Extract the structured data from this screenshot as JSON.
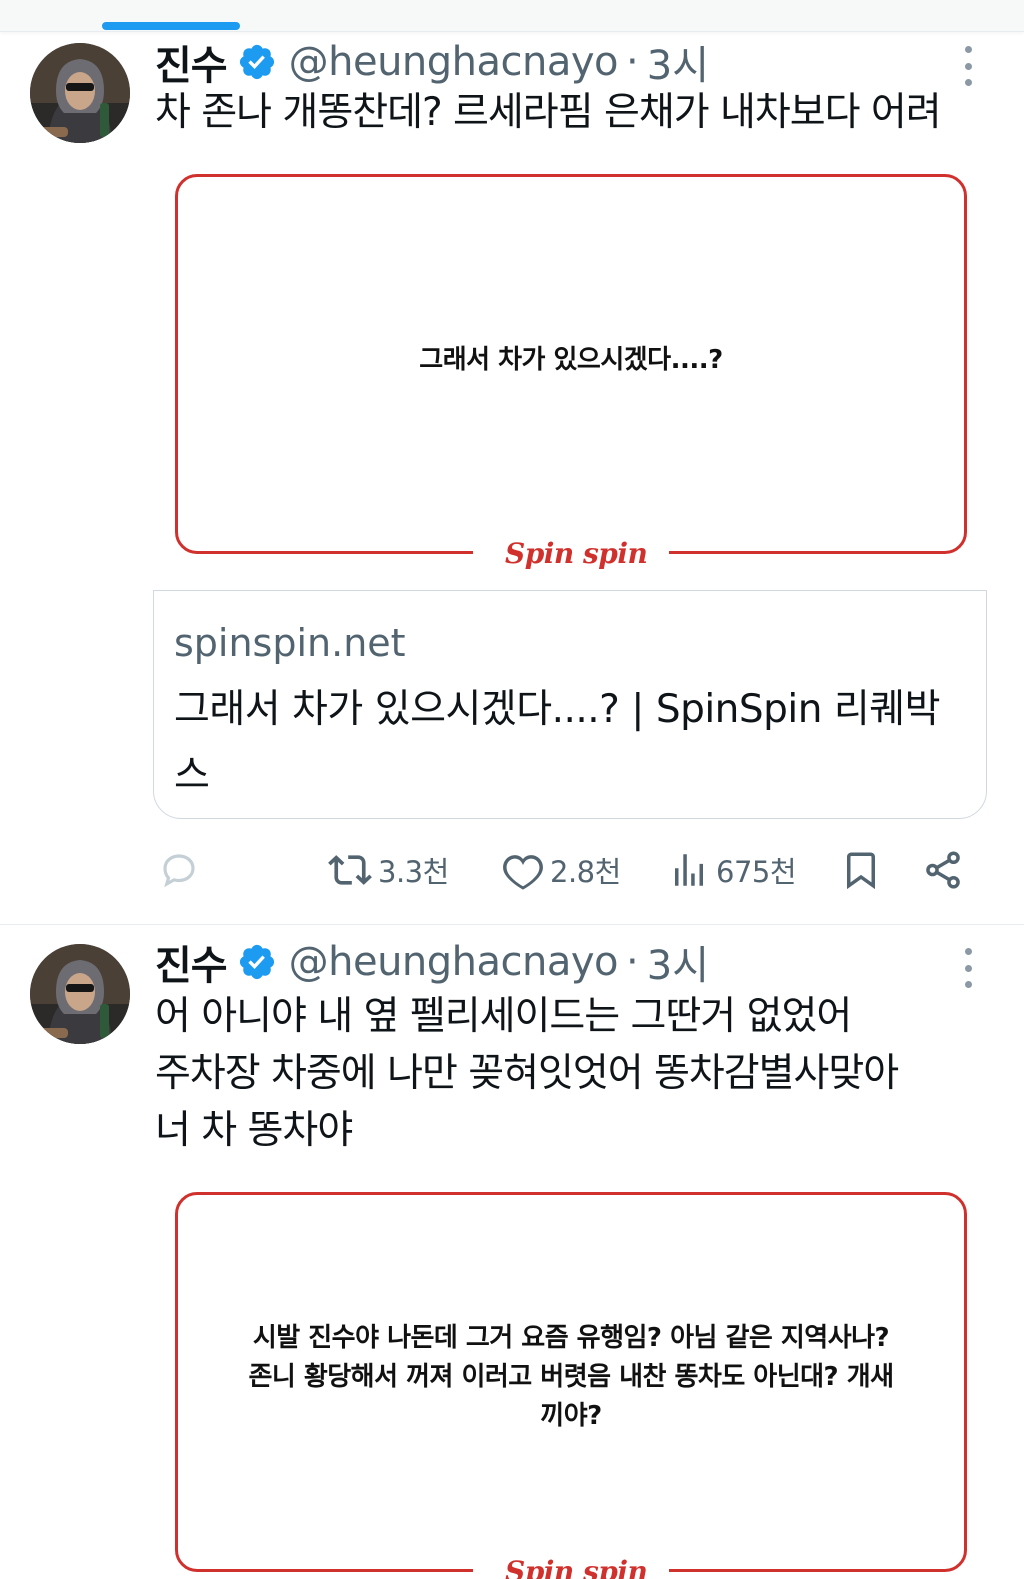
{
  "tweets": [
    {
      "author_name": "진수",
      "handle": "@heunghacnayo",
      "separator": "·",
      "time": "3시",
      "text": "차 존나 개똥찬데? 르세라핌 은채가 내차보다 어려",
      "media_text": "그래서 차가 있으시겠다....?",
      "media_brand": "Spin spin",
      "link_domain": "spinspin.net",
      "link_title": "그래서 차가 있으시겠다....? | SpinSpin 리퀘박스",
      "retweets": "3.3천",
      "likes": "2.8천",
      "views": "675천"
    },
    {
      "author_name": "진수",
      "handle": "@heunghacnayo",
      "separator": "·",
      "time": "3시",
      "text": "어 아니야 내 옆 펠리세이드는 그딴거 없었어\n주차장 차중에 나만 꽂혀잇엇어 똥차감별사맞아\n너 차 똥차야",
      "media_text": "시발 진수야 나돈데 그거 요즘 유행임? 아님 같은 지역사나?\n존니 황당해서 꺼져 이러고 버렷음 내찬 똥차도 아닌대? 개새\n끼야?",
      "media_brand": "Spin spin"
    }
  ],
  "colors": {
    "accent": "#1d9bf0",
    "frame_red": "#d0312d",
    "muted_text": "#536471"
  },
  "icons": [
    "verified-badge-icon",
    "more-options-icon",
    "reply-icon",
    "retweet-icon",
    "like-icon",
    "views-icon",
    "bookmark-icon",
    "share-icon"
  ]
}
